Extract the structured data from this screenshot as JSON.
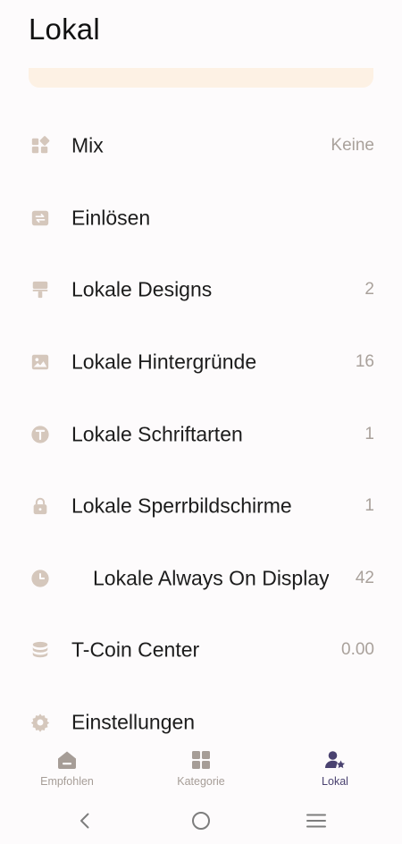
{
  "header": {
    "title": "Lokal"
  },
  "menu": {
    "items": [
      {
        "label": "Mix",
        "value": "Keine",
        "icon": "widgets-icon"
      },
      {
        "label": "Einlösen",
        "value": "",
        "icon": "exchange-icon"
      },
      {
        "label": "Lokale Designs",
        "value": "2",
        "icon": "paint-roller-icon"
      },
      {
        "label": "Lokale Hintergründe",
        "value": "16",
        "icon": "image-icon"
      },
      {
        "label": "Lokale Schriftarten",
        "value": "1",
        "icon": "font-icon"
      },
      {
        "label": "Lokale Sperrbildschirme",
        "value": "1",
        "icon": "lock-icon"
      },
      {
        "label": "Lokale Always On Display",
        "value": "42",
        "icon": "clock-icon"
      },
      {
        "label": "T-Coin Center",
        "value": "0.00",
        "icon": "coin-stack-icon"
      },
      {
        "label": "Einstellungen",
        "value": "",
        "icon": "gear-icon"
      }
    ]
  },
  "bottom_nav": {
    "tabs": [
      {
        "label": "Empfohlen",
        "icon": "home-icon",
        "active": false
      },
      {
        "label": "Kategorie",
        "icon": "grid-icon",
        "active": false
      },
      {
        "label": "Lokal",
        "icon": "user-star-icon",
        "active": true
      }
    ]
  },
  "colors": {
    "icon_tint": "#d5c7bc",
    "value_text": "#a9a19b",
    "banner": "#fdf1e4",
    "active_tab": "#4a4270",
    "inactive_tab": "#a69d97"
  },
  "system_nav": {
    "icons": [
      "back-icon",
      "home-circle-icon",
      "recents-menu-icon"
    ]
  }
}
